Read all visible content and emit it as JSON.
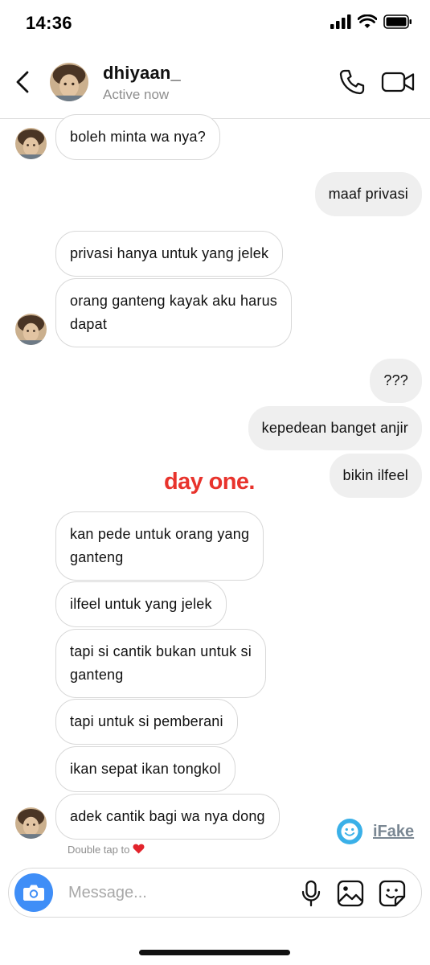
{
  "status_bar": {
    "time": "14:36"
  },
  "header": {
    "username": "dhiyaan_",
    "status": "Active now"
  },
  "messages": [
    {
      "side": "in",
      "text": "boleh minta wa nya?"
    },
    {
      "side": "out",
      "text": "maaf privasi"
    },
    {
      "side": "in",
      "text": "privasi hanya untuk yang jelek"
    },
    {
      "side": "in",
      "line1": "orang ganteng kayak aku harus",
      "line2": "dapat"
    },
    {
      "side": "out",
      "text": "???"
    },
    {
      "side": "out",
      "text": "kepedean banget anjir"
    },
    {
      "side": "out",
      "text": "bikin ilfeel"
    },
    {
      "side": "in",
      "line1": "kan pede untuk orang yang",
      "line2": "ganteng"
    },
    {
      "side": "in",
      "text": "ilfeel untuk yang jelek"
    },
    {
      "side": "in",
      "line1": "tapi si cantik bukan untuk si",
      "line2": "ganteng"
    },
    {
      "side": "in",
      "text": "tapi untuk si pemberani"
    },
    {
      "side": "in",
      "text": "ikan sepat ikan tongkol"
    },
    {
      "side": "in",
      "text": "adek cantik bagi wa nya dong"
    }
  ],
  "overlay_text": "day one.",
  "reaction_hint": "Double tap to",
  "watermark": "iFake",
  "composer": {
    "placeholder": "Message..."
  },
  "colors": {
    "overlay": "#e8332c",
    "camera_button": "#3f8ef7",
    "outgoing_bubble": "#efefef",
    "incoming_border": "#d8d8d8",
    "secondary_text": "#8e8e8e",
    "watermark_icon": "#3ab0e8"
  },
  "icons": {
    "status": [
      "signal-icon",
      "wifi-icon",
      "battery-icon"
    ],
    "header": [
      "back-arrow-icon",
      "phone-icon",
      "video-camera-icon"
    ],
    "composer": [
      "camera-icon",
      "microphone-icon",
      "gallery-icon",
      "sticker-icon"
    ],
    "reaction": "heart-icon"
  }
}
